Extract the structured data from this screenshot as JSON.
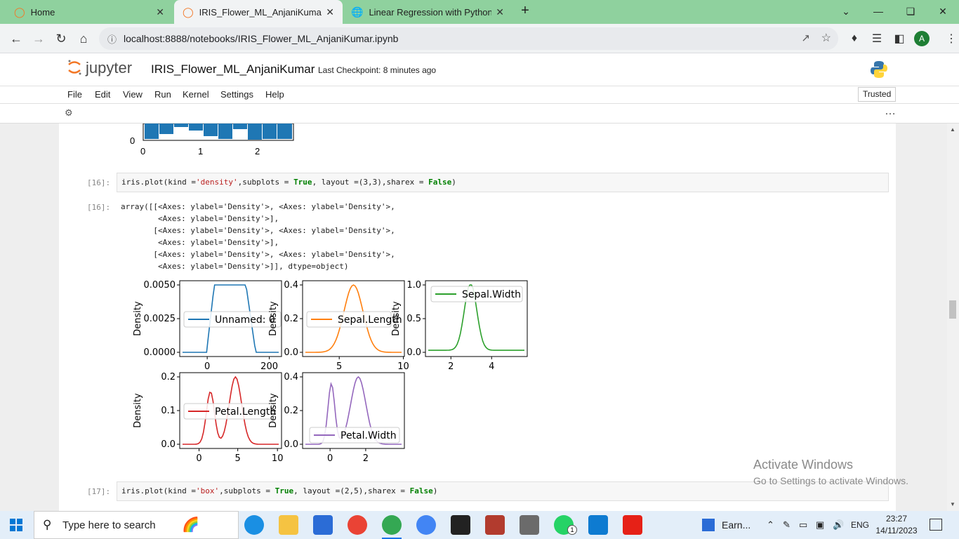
{
  "browser": {
    "tabs": [
      {
        "title": "Home",
        "icon": "jupyter-icon"
      },
      {
        "title": "IRIS_Flower_ML_AnjaniKumar",
        "icon": "jupyter-icon"
      },
      {
        "title": "Linear Regression with Python",
        "icon": "globe-icon"
      }
    ],
    "address": "localhost:8888/notebooks/IRIS_Flower_ML_AnjaniKumar.ipynb",
    "profile_initial": "A"
  },
  "jupyter": {
    "logo_text": "jupyter",
    "notebook_name": "IRIS_Flower_ML_AnjaniKumar",
    "checkpoint": "Last Checkpoint: 8 minutes ago",
    "menu": [
      "File",
      "Edit",
      "View",
      "Run",
      "Kernel",
      "Settings",
      "Help"
    ],
    "trusted": "Trusted",
    "more": "…"
  },
  "notebook": {
    "prev_plot_ticks": {
      "x": [
        "0",
        "1",
        "2"
      ],
      "y0": "0"
    },
    "cell16": {
      "in_prompt": "[16]:",
      "out_prompt": "[16]:",
      "code_parts": [
        "iris.plot(kind =",
        "'density'",
        ",subplots = ",
        "True",
        ", layout =(3,3),sharex = ",
        "False",
        ")"
      ],
      "output": "array([[<Axes: ylabel='Density'>, <Axes: ylabel='Density'>,\n        <Axes: ylabel='Density'>],\n       [<Axes: ylabel='Density'>, <Axes: ylabel='Density'>,\n        <Axes: ylabel='Density'>],\n       [<Axes: ylabel='Density'>, <Axes: ylabel='Density'>,\n        <Axes: ylabel='Density'>]], dtype=object)"
    },
    "cell17": {
      "in_prompt": "[17]:",
      "code_parts": [
        "iris.plot(kind =",
        "'box'",
        ",subplots = ",
        "True",
        ", layout =(2,5),sharex = ",
        "False",
        ")"
      ]
    }
  },
  "chart_data": [
    {
      "type": "line",
      "series": [
        {
          "name": "Unnamed: 0",
          "color": "#1f77b4"
        }
      ],
      "ylabel": "Density",
      "yticks": [
        "0.0000",
        "0.0025",
        "0.0050"
      ],
      "xticks": [
        "0",
        "200"
      ],
      "legend": "Unnamed: 0"
    },
    {
      "type": "line",
      "series": [
        {
          "name": "Sepal.Length",
          "color": "#ff7f0e"
        }
      ],
      "ylabel": "Density",
      "yticks": [
        "0.0",
        "0.2",
        "0.4"
      ],
      "xticks": [
        "5",
        "10"
      ],
      "legend": "Sepal.Length"
    },
    {
      "type": "line",
      "series": [
        {
          "name": "Sepal.Width",
          "color": "#2ca02c"
        }
      ],
      "ylabel": "Density",
      "yticks": [
        "0.0",
        "0.5",
        "1.0"
      ],
      "xticks": [
        "2",
        "4"
      ],
      "legend": "Sepal.Width"
    },
    {
      "type": "line",
      "series": [
        {
          "name": "Petal.Length",
          "color": "#d62728"
        }
      ],
      "ylabel": "Density",
      "yticks": [
        "0.0",
        "0.1",
        "0.2"
      ],
      "xticks": [
        "0",
        "5",
        "10"
      ],
      "legend": "Petal.Length"
    },
    {
      "type": "line",
      "series": [
        {
          "name": "Petal.Width",
          "color": "#9467bd"
        }
      ],
      "ylabel": "Density",
      "yticks": [
        "0.0",
        "0.2",
        "0.4"
      ],
      "xticks": [
        "0",
        "2"
      ],
      "legend": "Petal.Width"
    }
  ],
  "watermark": {
    "line1": "Activate Windows",
    "line2": "Go to Settings to activate Windows."
  },
  "taskbar": {
    "search_placeholder": "Type here to search",
    "pinned_label": "Earn...",
    "language": "ENG",
    "time": "23:27",
    "date": "14/11/2023",
    "whatsapp_badge": "1"
  }
}
